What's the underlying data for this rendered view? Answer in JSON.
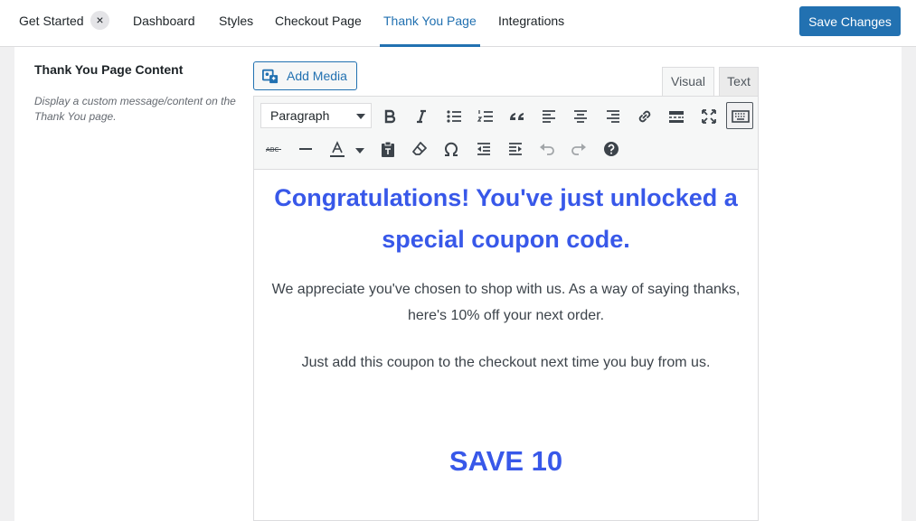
{
  "nav": {
    "tabs": [
      {
        "label": "Get Started"
      },
      {
        "label": "Dashboard"
      },
      {
        "label": "Styles"
      },
      {
        "label": "Checkout Page"
      },
      {
        "label": "Thank You Page",
        "active": true
      },
      {
        "label": "Integrations"
      }
    ],
    "close_glyph": "×",
    "save_label": "Save Changes"
  },
  "field": {
    "title": "Thank You Page Content",
    "description": "Display a custom message/content on the Thank You page."
  },
  "editor": {
    "add_media_label": "Add Media",
    "mode_tabs": {
      "visual": "Visual",
      "text": "Text"
    },
    "format_value": "Paragraph",
    "toolbar_row1": [
      "bold-icon",
      "italic-icon",
      "bullet-list-icon",
      "numbered-list-icon",
      "blockquote-icon",
      "align-left-icon",
      "align-center-icon",
      "align-right-icon",
      "link-icon",
      "read-more-icon",
      "fullscreen-icon",
      "toolbar-toggle-icon"
    ],
    "toolbar_row2": [
      "strikethrough-icon",
      "horizontal-line-icon",
      "text-color-icon",
      "paste-text-icon",
      "clear-formatting-icon",
      "special-character-icon",
      "outdent-icon",
      "indent-icon",
      "undo-icon",
      "redo-icon",
      "help-icon"
    ],
    "content": {
      "heading_line1": "Congratulations! You've just unlocked a",
      "heading_line2": "special coupon code.",
      "paragraph1": "We appreciate you've chosen to shop with us. As a way of saying thanks, here's 10% off your next order.",
      "paragraph2": "Just add this coupon to the checkout next time you buy from us.",
      "coupon_code": "SAVE 10"
    }
  },
  "colors": {
    "accent": "#2271b1",
    "content_accent": "#3858e9"
  }
}
